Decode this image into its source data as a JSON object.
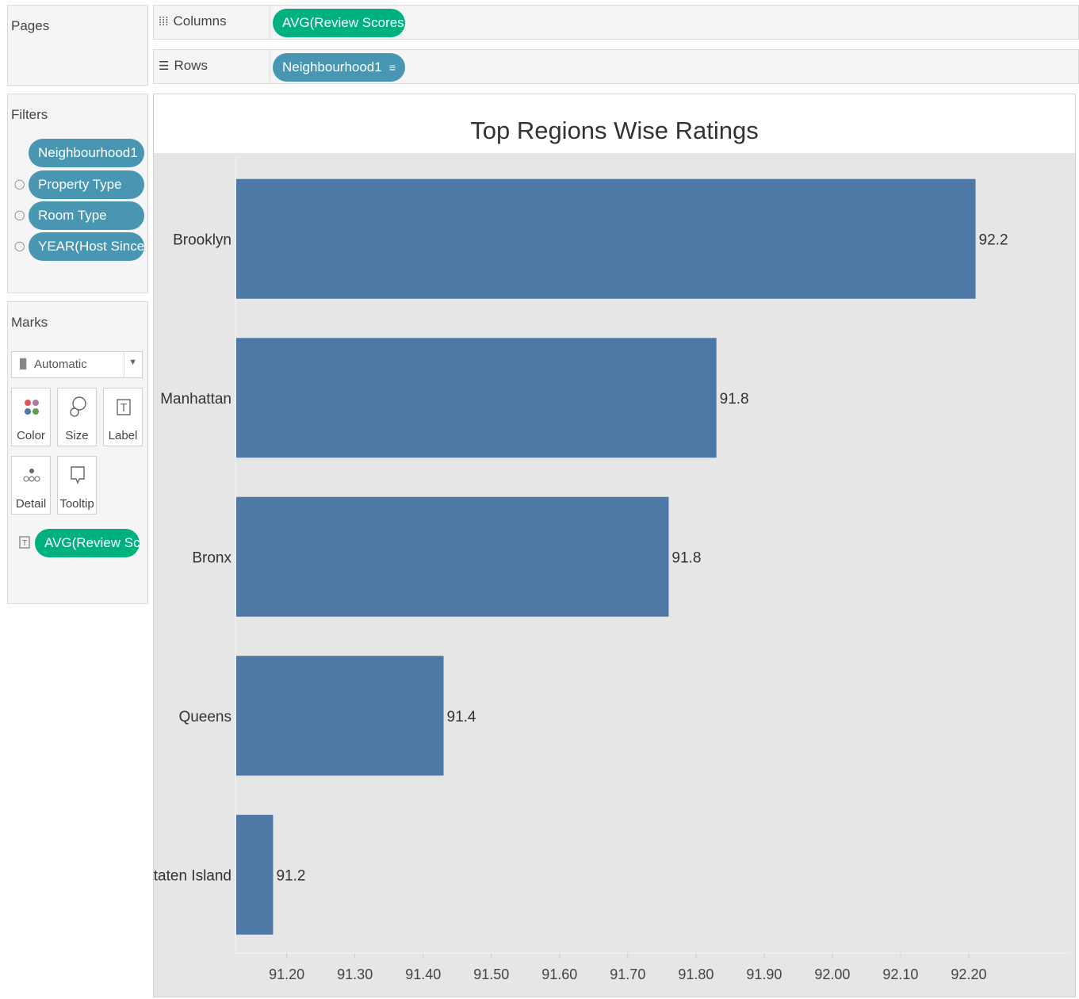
{
  "pages": {
    "title": "Pages"
  },
  "columns_shelf": {
    "label": "Columns",
    "pill": "AVG(Review Scores .."
  },
  "rows_shelf": {
    "label": "Rows",
    "pill": "Neighbourhood1"
  },
  "filters": {
    "title": "Filters",
    "items": [
      {
        "label": "Neighbourhood1"
      },
      {
        "label": "Property Type"
      },
      {
        "label": "Room Type"
      },
      {
        "label": "YEAR(Host Since)"
      }
    ]
  },
  "marks": {
    "title": "Marks",
    "mark_type": "Automatic",
    "buttons": {
      "color": "Color",
      "size": "Size",
      "label": "Label",
      "detail": "Detail",
      "tooltip": "Tooltip"
    },
    "field_pill": "AVG(Review Sc.."
  },
  "colors": {
    "bar": "#4e79a7",
    "dimension_pill": "#4996b2",
    "measure_pill": "#00b180",
    "plot_bg": "#e6e6e6"
  },
  "chart_data": {
    "type": "bar",
    "orientation": "horizontal",
    "title": "Top Regions Wise Ratings",
    "categories": [
      "Brooklyn",
      "Manhattan",
      "Bronx",
      "Queens",
      "Staten Island"
    ],
    "values": [
      92.21,
      91.83,
      91.76,
      91.43,
      91.18
    ],
    "value_labels": [
      "92.2",
      "91.8",
      "91.8",
      "91.4",
      "91.2"
    ],
    "xlim": [
      91.126,
      92.35
    ],
    "x_ticks": [
      91.2,
      91.3,
      91.4,
      91.5,
      91.6,
      91.7,
      91.8,
      91.9,
      92.0,
      92.1,
      92.2
    ],
    "x_tick_labels": [
      "91.20",
      "91.30",
      "91.40",
      "91.50",
      "91.60",
      "91.70",
      "91.80",
      "91.90",
      "92.00",
      "92.10",
      "92.20"
    ],
    "xlabel": "",
    "ylabel": "",
    "grid": false
  }
}
